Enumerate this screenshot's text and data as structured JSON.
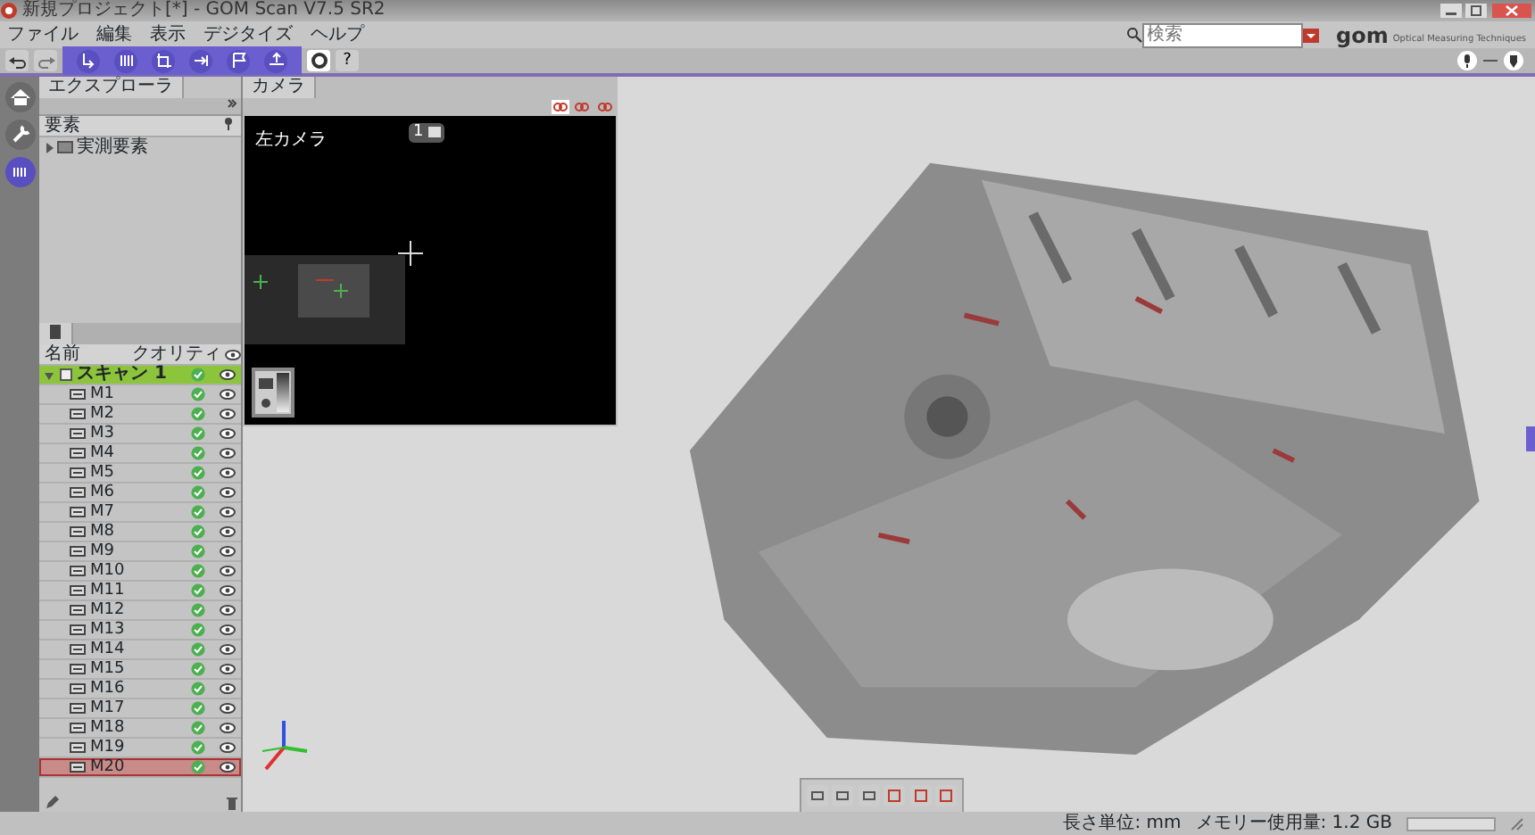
{
  "window": {
    "title": "新規プロジェクト[*] - GOM Scan V7.5 SR2"
  },
  "menu": [
    "ファイル",
    "編集",
    "表示",
    "デジタイズ",
    "ヘルプ"
  ],
  "search": {
    "placeholder": "検索"
  },
  "logo": {
    "name": "gom",
    "tagline": "Optical Measuring Techniques"
  },
  "toolbar": {
    "help": "?"
  },
  "explorer": {
    "tab": "エクスプローラ",
    "column": "要素",
    "tree": [
      {
        "label": "実測要素",
        "expanded": false
      }
    ]
  },
  "camera": {
    "tab": "カメラ",
    "views": [
      {
        "selected": true
      },
      {
        "selected": false
      },
      {
        "selected": false
      }
    ],
    "label": "左カメラ",
    "counter": "1"
  },
  "scans": {
    "columns": [
      "名前",
      "クオリティ"
    ],
    "rows": [
      {
        "name": "スキャン 1",
        "expanded": true,
        "selected": true,
        "marked": false,
        "ok": true,
        "visible": true,
        "children": [
          {
            "name": "M1",
            "selected": false,
            "marked": false,
            "ok": true,
            "visible": true
          },
          {
            "name": "M2",
            "selected": false,
            "marked": false,
            "ok": true,
            "visible": true
          },
          {
            "name": "M3",
            "selected": false,
            "marked": false,
            "ok": true,
            "visible": true
          },
          {
            "name": "M4",
            "selected": false,
            "marked": false,
            "ok": true,
            "visible": true
          },
          {
            "name": "M5",
            "selected": false,
            "marked": false,
            "ok": true,
            "visible": true
          },
          {
            "name": "M6",
            "selected": false,
            "marked": false,
            "ok": true,
            "visible": true
          },
          {
            "name": "M7",
            "selected": false,
            "marked": false,
            "ok": true,
            "visible": true
          },
          {
            "name": "M8",
            "selected": false,
            "marked": false,
            "ok": true,
            "visible": true
          },
          {
            "name": "M9",
            "selected": false,
            "marked": false,
            "ok": true,
            "visible": true
          },
          {
            "name": "M10",
            "selected": false,
            "marked": false,
            "ok": true,
            "visible": true
          },
          {
            "name": "M11",
            "selected": false,
            "marked": false,
            "ok": true,
            "visible": true
          },
          {
            "name": "M12",
            "selected": false,
            "marked": false,
            "ok": true,
            "visible": true
          },
          {
            "name": "M13",
            "selected": false,
            "marked": false,
            "ok": true,
            "visible": true
          },
          {
            "name": "M14",
            "selected": false,
            "marked": false,
            "ok": true,
            "visible": true
          },
          {
            "name": "M15",
            "selected": false,
            "marked": false,
            "ok": true,
            "visible": true
          },
          {
            "name": "M16",
            "selected": false,
            "marked": false,
            "ok": true,
            "visible": true
          },
          {
            "name": "M17",
            "selected": false,
            "marked": false,
            "ok": true,
            "visible": true
          },
          {
            "name": "M18",
            "selected": false,
            "marked": false,
            "ok": true,
            "visible": true
          },
          {
            "name": "M19",
            "selected": false,
            "marked": false,
            "ok": true,
            "visible": true
          },
          {
            "name": "M20",
            "selected": false,
            "marked": true,
            "ok": true,
            "visible": true
          }
        ]
      }
    ]
  },
  "status_bar": {
    "unit": "長さ単位: mm",
    "memory": "メモリー使用量: 1.2 GB",
    "progress": {
      "level": 0
    }
  }
}
